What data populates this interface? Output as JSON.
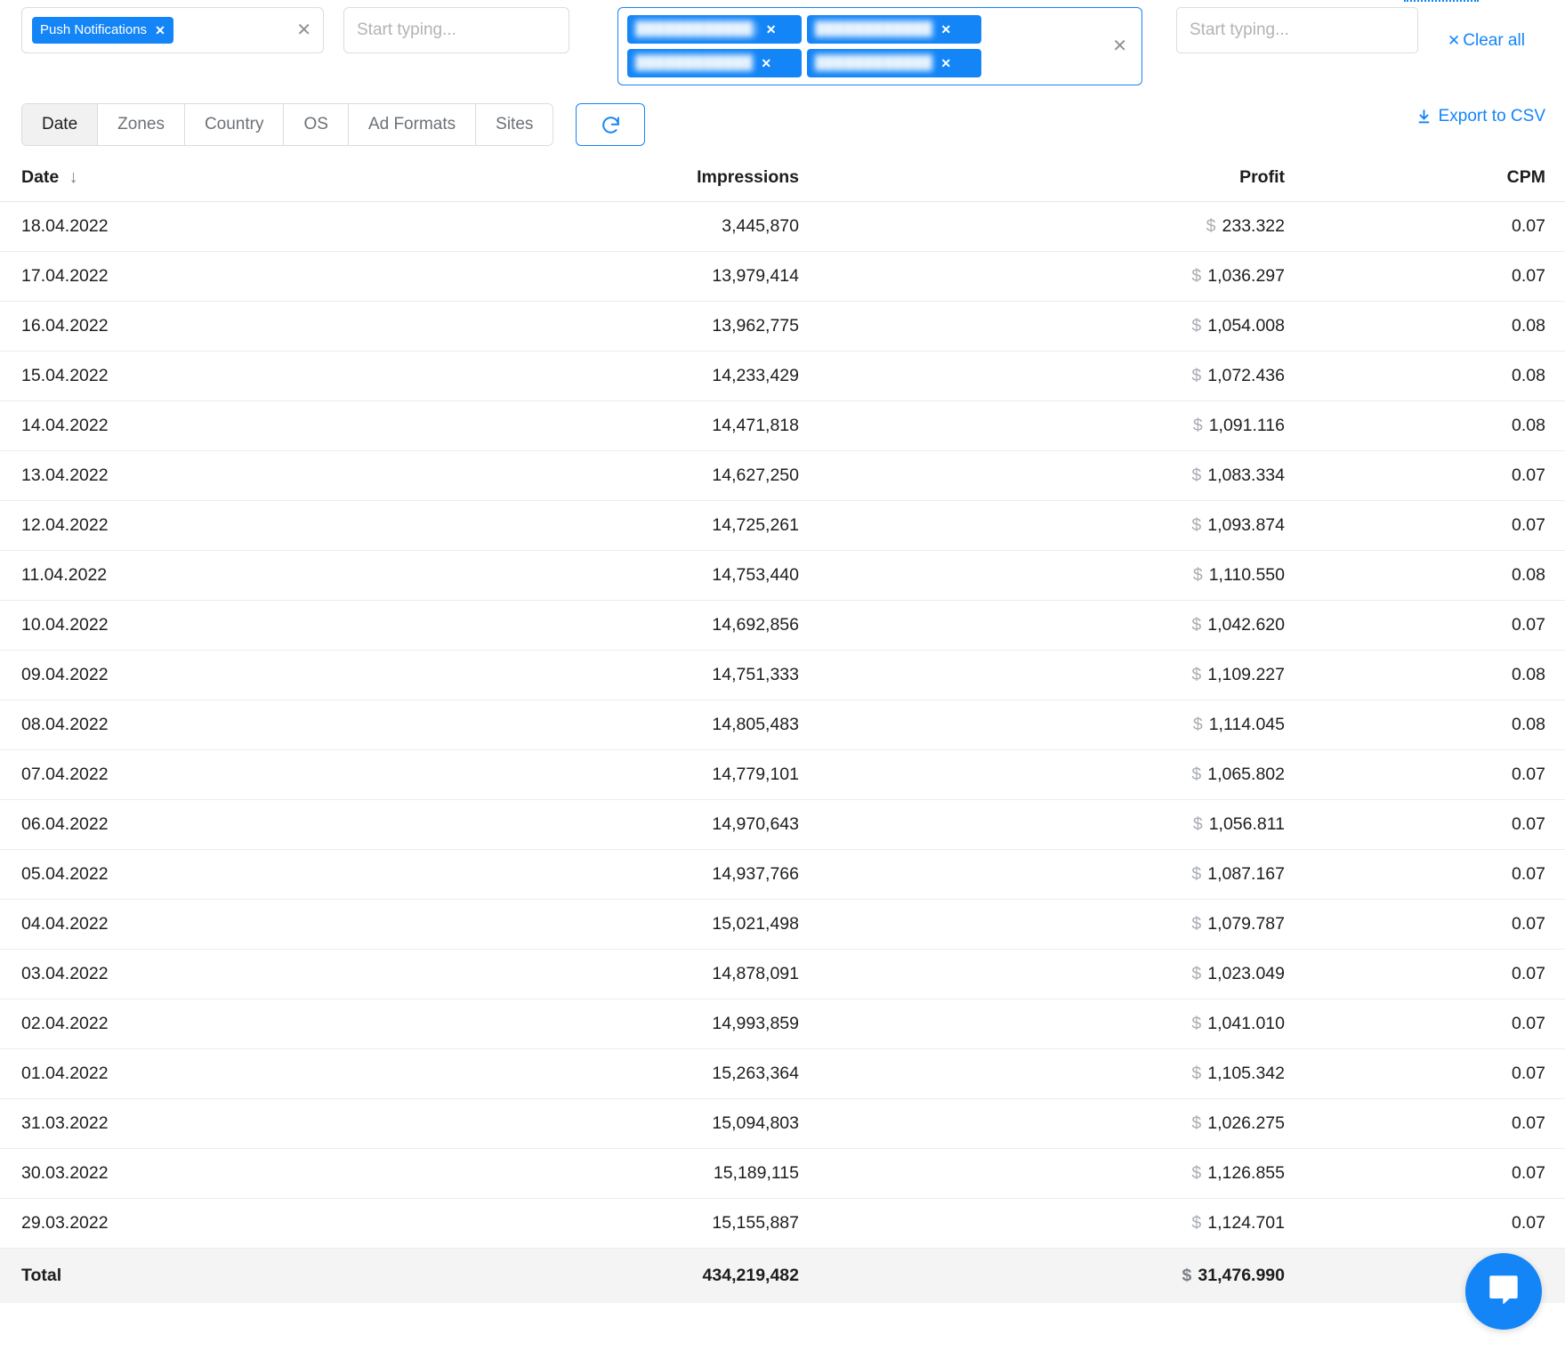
{
  "filters": {
    "ad_format_field": {
      "tags": [
        {
          "label": "Push Notifications",
          "remove": "✕"
        }
      ],
      "clear_icon": "✕"
    },
    "empty_field_1": {
      "placeholder": "Start typing..."
    },
    "multi_field": {
      "tags": [
        {
          "label": "████████████)",
          "remove": "✕"
        },
        {
          "label": "████████████",
          "remove": "✕"
        },
        {
          "label": "████████████",
          "remove": "✕"
        },
        {
          "label": "████████████",
          "remove": "✕"
        }
      ],
      "clear_icon": "✕"
    },
    "empty_field_2": {
      "placeholder": "Start typing..."
    },
    "clear_all": {
      "icon": "✕",
      "label": "Clear all"
    }
  },
  "toolbar": {
    "tabs": [
      {
        "label": "Date",
        "active": true
      },
      {
        "label": "Zones",
        "active": false
      },
      {
        "label": "Country",
        "active": false
      },
      {
        "label": "OS",
        "active": false
      },
      {
        "label": "Ad Formats",
        "active": false
      },
      {
        "label": "Sites",
        "active": false
      }
    ],
    "refresh_icon": "refresh-icon",
    "export_label": "Export to CSV",
    "export_icon": "download-icon"
  },
  "table": {
    "columns": [
      {
        "key": "date",
        "label": "Date",
        "sort": "↓"
      },
      {
        "key": "impressions",
        "label": "Impressions"
      },
      {
        "key": "profit",
        "label": "Profit"
      },
      {
        "key": "cpm",
        "label": "CPM"
      }
    ],
    "currency_symbol": "$",
    "rows": [
      {
        "date": "18.04.2022",
        "impressions": "3,445,870",
        "profit": "233.322",
        "cpm": "0.07"
      },
      {
        "date": "17.04.2022",
        "impressions": "13,979,414",
        "profit": "1,036.297",
        "cpm": "0.07"
      },
      {
        "date": "16.04.2022",
        "impressions": "13,962,775",
        "profit": "1,054.008",
        "cpm": "0.08"
      },
      {
        "date": "15.04.2022",
        "impressions": "14,233,429",
        "profit": "1,072.436",
        "cpm": "0.08"
      },
      {
        "date": "14.04.2022",
        "impressions": "14,471,818",
        "profit": "1,091.116",
        "cpm": "0.08"
      },
      {
        "date": "13.04.2022",
        "impressions": "14,627,250",
        "profit": "1,083.334",
        "cpm": "0.07"
      },
      {
        "date": "12.04.2022",
        "impressions": "14,725,261",
        "profit": "1,093.874",
        "cpm": "0.07"
      },
      {
        "date": "11.04.2022",
        "impressions": "14,753,440",
        "profit": "1,110.550",
        "cpm": "0.08"
      },
      {
        "date": "10.04.2022",
        "impressions": "14,692,856",
        "profit": "1,042.620",
        "cpm": "0.07"
      },
      {
        "date": "09.04.2022",
        "impressions": "14,751,333",
        "profit": "1,109.227",
        "cpm": "0.08"
      },
      {
        "date": "08.04.2022",
        "impressions": "14,805,483",
        "profit": "1,114.045",
        "cpm": "0.08"
      },
      {
        "date": "07.04.2022",
        "impressions": "14,779,101",
        "profit": "1,065.802",
        "cpm": "0.07"
      },
      {
        "date": "06.04.2022",
        "impressions": "14,970,643",
        "profit": "1,056.811",
        "cpm": "0.07"
      },
      {
        "date": "05.04.2022",
        "impressions": "14,937,766",
        "profit": "1,087.167",
        "cpm": "0.07"
      },
      {
        "date": "04.04.2022",
        "impressions": "15,021,498",
        "profit": "1,079.787",
        "cpm": "0.07"
      },
      {
        "date": "03.04.2022",
        "impressions": "14,878,091",
        "profit": "1,023.049",
        "cpm": "0.07"
      },
      {
        "date": "02.04.2022",
        "impressions": "14,993,859",
        "profit": "1,041.010",
        "cpm": "0.07"
      },
      {
        "date": "01.04.2022",
        "impressions": "15,263,364",
        "profit": "1,105.342",
        "cpm": "0.07"
      },
      {
        "date": "31.03.2022",
        "impressions": "15,094,803",
        "profit": "1,026.275",
        "cpm": "0.07"
      },
      {
        "date": "30.03.2022",
        "impressions": "15,189,115",
        "profit": "1,126.855",
        "cpm": "0.07"
      },
      {
        "date": "29.03.2022",
        "impressions": "15,155,887",
        "profit": "1,124.701",
        "cpm": "0.07"
      }
    ],
    "total": {
      "label": "Total",
      "impressions": "434,219,482",
      "profit": "31,476.990",
      "cpm": ""
    }
  },
  "chat": {
    "icon": "chat-bubble-icon"
  },
  "colors": {
    "accent": "#1485f7",
    "tag_bg": "#1485f7",
    "total_bg": "#f4f4f4",
    "border": "#dcdcdc"
  }
}
